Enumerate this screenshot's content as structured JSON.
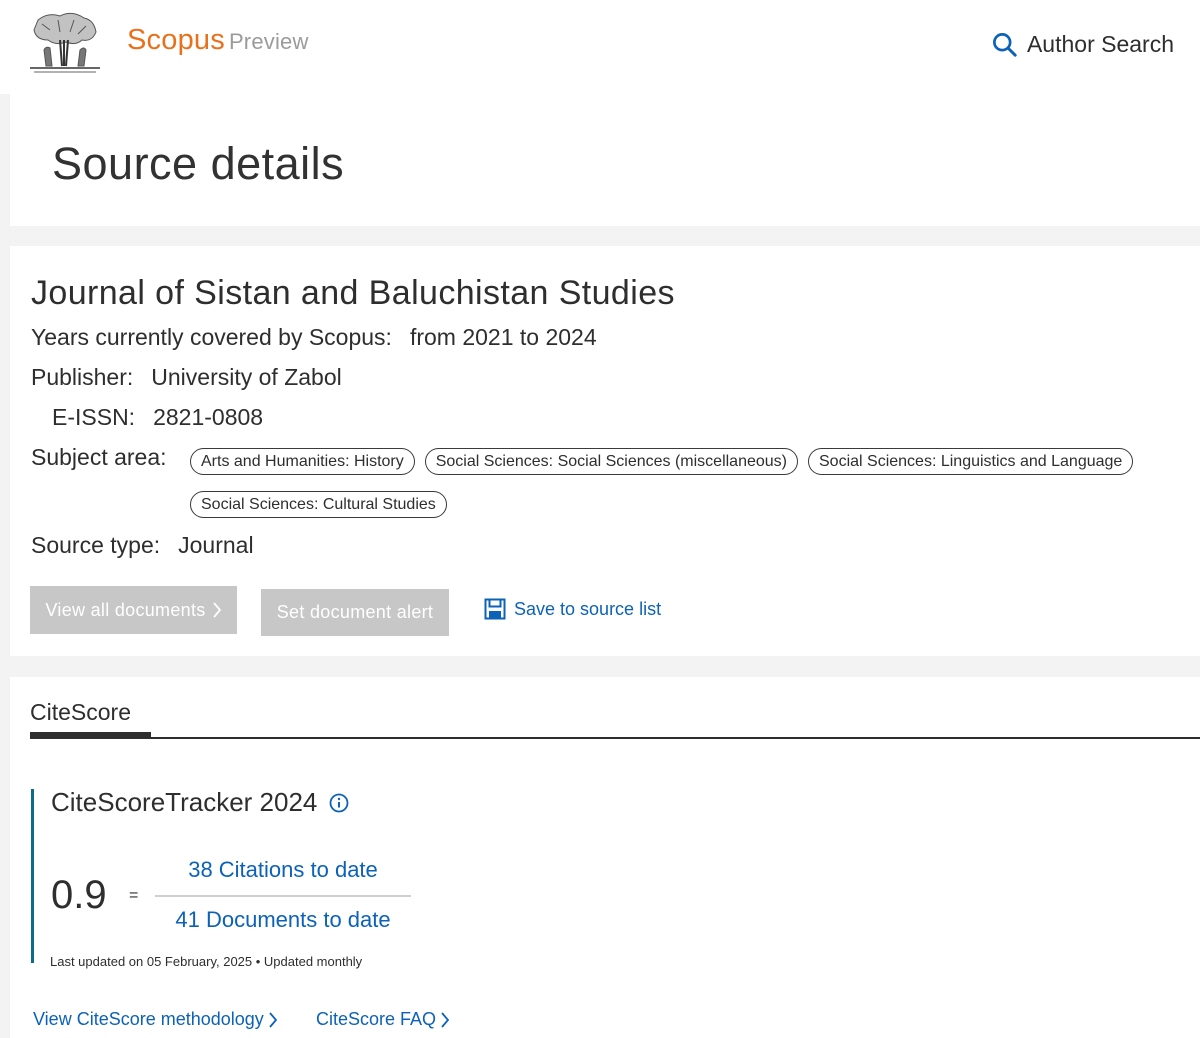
{
  "header": {
    "brand": "Scopus",
    "brand_suffix": "Preview",
    "author_search_label": "Author Search",
    "logo_icon": "elsevier-tree-logo",
    "search_icon": "search-icon"
  },
  "page": {
    "title": "Source details"
  },
  "source": {
    "journal_title": "Journal of Sistan and Baluchistan Studies",
    "years_label": "Years currently covered by Scopus:",
    "years_value": "from 2021 to 2024",
    "publisher_label": "Publisher:",
    "publisher_value": "University of Zabol",
    "eissn_label": "E-ISSN:",
    "eissn_value": "2821-0808",
    "subject_label": "Subject area:",
    "subjects": [
      "Arts and Humanities: History",
      "Social Sciences: Social Sciences (miscellaneous)",
      "Social Sciences: Linguistics and Language",
      "Social Sciences: Cultural Studies"
    ],
    "type_label": "Source type:",
    "type_value": "Journal",
    "view_all_label": "View all documents",
    "alert_label": "Set document alert",
    "save_label": "Save to source list"
  },
  "citescore": {
    "tab_label": "CiteScore",
    "tracker_title": "CiteScoreTracker 2024",
    "score": "0.9",
    "equals": "=",
    "citations": "38 Citations to date",
    "documents": "41 Documents to date",
    "updated": "Last updated on 05 February, 2025 • Updated monthly",
    "methodology_link": "View CiteScore methodology",
    "faq_link": "CiteScore FAQ"
  },
  "colors": {
    "brand_orange": "#e9711c",
    "link_blue": "#0c62b8",
    "tracker_accent": "#0b6e88",
    "disabled_button": "#c7c7c7"
  }
}
